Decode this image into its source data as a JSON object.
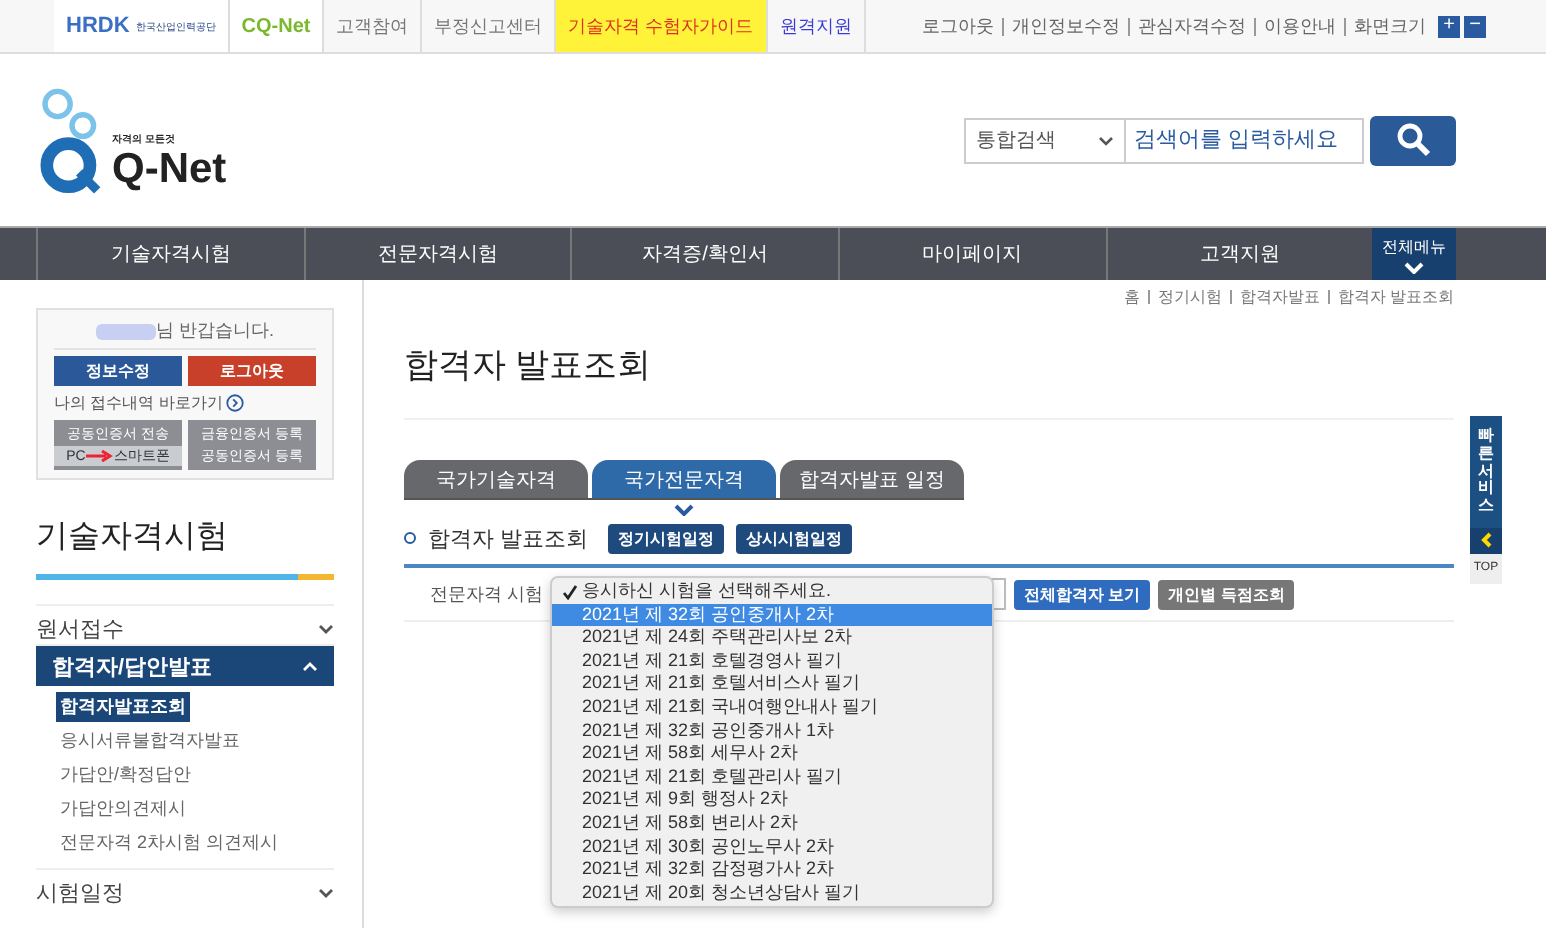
{
  "utility_bar": {
    "hrdk_logo": {
      "mark": "HRDK",
      "org": "한국산업인력공단"
    },
    "cqnet_logo": "CQ-Net",
    "links": [
      {
        "label": "고객참여",
        "kind": "plain"
      },
      {
        "label": "부정신고센터",
        "kind": "plain"
      },
      {
        "label": "기술자격 수험자가이드",
        "kind": "highlight"
      },
      {
        "label": "원격지원",
        "kind": "accent"
      }
    ],
    "user_links": [
      "로그아웃",
      "개인정보수정",
      "관심자격수정",
      "이용안내"
    ],
    "font_size": {
      "label": "화면크기",
      "buttons": [
        "+",
        "−"
      ]
    }
  },
  "header": {
    "logo": {
      "tagline": "자격의 모든것",
      "name": "Q-Net"
    },
    "search": {
      "scope": "통합검색",
      "placeholder": "검색어를 입력하세요"
    }
  },
  "nav": {
    "items": [
      "기술자격시험",
      "전문자격시험",
      "자격증/확인서",
      "마이페이지",
      "고객지원"
    ],
    "all_menu": "전체메뉴"
  },
  "sidebar": {
    "greeting": "님 반갑습니다.",
    "buttons": [
      {
        "label": "정보수정",
        "kind": "primary"
      },
      {
        "label": "로그아웃",
        "kind": "danger"
      }
    ],
    "shortcut": "나의 접수내역 바로가기",
    "cert_buttons": [
      {
        "title": "공동인증서 전송",
        "from": "PC",
        "to": "스마트폰"
      },
      {
        "title": "금융인증서 등록",
        "subtitle": "공동인증서 등록"
      }
    ],
    "section_title": "기술자격시험",
    "menu": [
      {
        "label": "원서접수",
        "expanded": false
      },
      {
        "label": "합격자/답안발표",
        "expanded": true,
        "children": [
          {
            "label": "합격자발표조회",
            "selected": true
          },
          {
            "label": "응시서류불합격자발표",
            "selected": false
          },
          {
            "label": "가답안/확정답안",
            "selected": false
          },
          {
            "label": "가답안의견제시",
            "selected": false
          },
          {
            "label": "전문자격 2차시험 의견제시",
            "selected": false
          }
        ]
      },
      {
        "label": "시험일정",
        "expanded": false
      }
    ]
  },
  "breadcrumb": [
    "홈",
    "정기시험",
    "합격자발표",
    "합격자 발표조회"
  ],
  "page_title": "합격자 발표조회",
  "tabs": [
    {
      "label": "국가기술자격",
      "selected": false
    },
    {
      "label": "국가전문자격",
      "selected": true
    },
    {
      "label": "합격자발표 일정",
      "selected": false
    }
  ],
  "subsection": {
    "title": "합격자 발표조회",
    "buttons": [
      "정기시험일정",
      "상시시험일정"
    ]
  },
  "filter": {
    "label": "전문자격 시험",
    "options": [
      {
        "label": "응시하신 시험을 선택해주세요.",
        "checked": true,
        "selected": false
      },
      {
        "label": "2021년 제 32회 공인중개사 2차",
        "checked": false,
        "selected": true
      },
      {
        "label": "2021년 제 24회 주택관리사보 2차",
        "checked": false,
        "selected": false
      },
      {
        "label": "2021년 제 21회 호텔경영사 필기",
        "checked": false,
        "selected": false
      },
      {
        "label": "2021년 제 21회 호텔서비스사 필기",
        "checked": false,
        "selected": false
      },
      {
        "label": "2021년 제 21회 국내여행안내사 필기",
        "checked": false,
        "selected": false
      },
      {
        "label": "2021년 제 32회 공인중개사 1차",
        "checked": false,
        "selected": false
      },
      {
        "label": "2021년 제 58회 세무사 2차",
        "checked": false,
        "selected": false
      },
      {
        "label": "2021년 제 21회 호텔관리사 필기",
        "checked": false,
        "selected": false
      },
      {
        "label": "2021년 제 9회 행정사 2차",
        "checked": false,
        "selected": false
      },
      {
        "label": "2021년 제 58회 변리사 2차",
        "checked": false,
        "selected": false
      },
      {
        "label": "2021년 제 30회 공인노무사 2차",
        "checked": false,
        "selected": false
      },
      {
        "label": "2021년 제 32회 감정평가사 2차",
        "checked": false,
        "selected": false
      },
      {
        "label": "2021년 제 20회 청소년상담사 필기",
        "checked": false,
        "selected": false
      }
    ],
    "buttons": [
      {
        "label": "전체합격자 보기",
        "kind": "primary"
      },
      {
        "label": "개인별 득점조회",
        "kind": "secondary"
      }
    ]
  },
  "quick_service": {
    "label": "빠른서비스",
    "top": "TOP"
  }
}
